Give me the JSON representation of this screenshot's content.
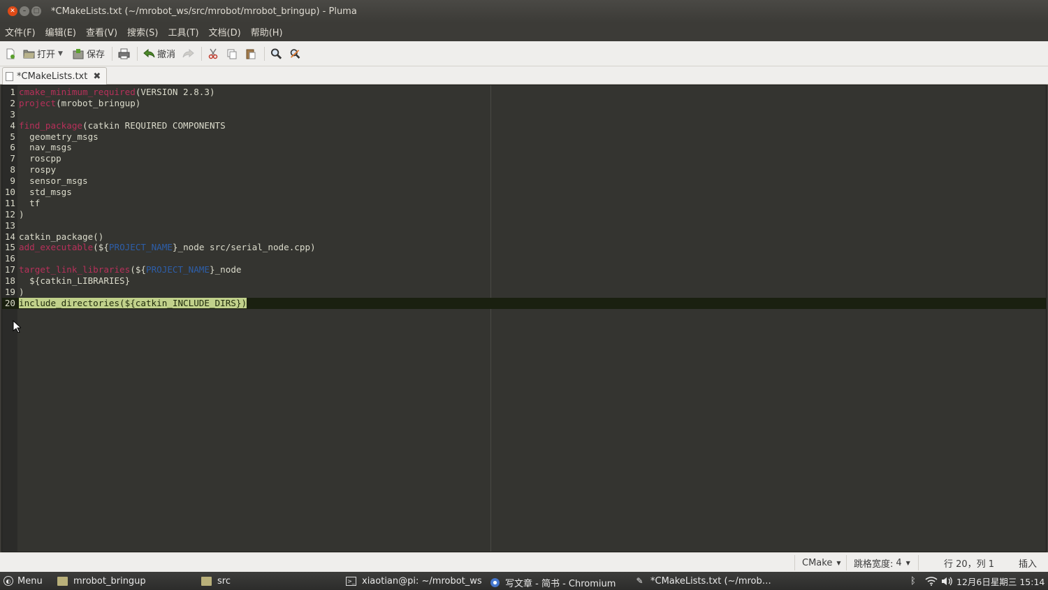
{
  "window": {
    "title": "*CMakeLists.txt (~/mrobot_ws/src/mrobot/mrobot_bringup) - Pluma"
  },
  "menu": {
    "items": [
      "文件(F)",
      "编辑(E)",
      "查看(V)",
      "搜索(S)",
      "工具(T)",
      "文档(D)",
      "帮助(H)"
    ]
  },
  "toolbar": {
    "open_label": "打开",
    "save_label": "保存",
    "undo_label": "撤消"
  },
  "tab": {
    "label": "*CMakeLists.txt"
  },
  "editor": {
    "current_line": 20,
    "lines": [
      {
        "n": "1",
        "segments": [
          {
            "t": "cmake_minimum_required",
            "c": "kw"
          },
          {
            "t": "(VERSION 2.8.3)",
            "c": "plain"
          }
        ]
      },
      {
        "n": "2",
        "segments": [
          {
            "t": "project",
            "c": "kw"
          },
          {
            "t": "(mrobot_bringup)",
            "c": "plain"
          }
        ]
      },
      {
        "n": "3",
        "segments": []
      },
      {
        "n": "4",
        "segments": [
          {
            "t": "find_package",
            "c": "kw"
          },
          {
            "t": "(catkin REQUIRED COMPONENTS",
            "c": "plain"
          }
        ]
      },
      {
        "n": "5",
        "segments": [
          {
            "t": "  geometry_msgs",
            "c": "plain"
          }
        ]
      },
      {
        "n": "6",
        "segments": [
          {
            "t": "  nav_msgs",
            "c": "plain"
          }
        ]
      },
      {
        "n": "7",
        "segments": [
          {
            "t": "  roscpp",
            "c": "plain"
          }
        ]
      },
      {
        "n": "8",
        "segments": [
          {
            "t": "  rospy",
            "c": "plain"
          }
        ]
      },
      {
        "n": "9",
        "segments": [
          {
            "t": "  sensor_msgs",
            "c": "plain"
          }
        ]
      },
      {
        "n": "10",
        "segments": [
          {
            "t": "  std_msgs",
            "c": "plain"
          }
        ]
      },
      {
        "n": "11",
        "segments": [
          {
            "t": "  tf",
            "c": "plain"
          }
        ]
      },
      {
        "n": "12",
        "segments": [
          {
            "t": ")",
            "c": "plain"
          }
        ]
      },
      {
        "n": "13",
        "segments": []
      },
      {
        "n": "14",
        "segments": [
          {
            "t": "catkin_package()",
            "c": "plain"
          }
        ]
      },
      {
        "n": "15",
        "segments": [
          {
            "t": "add_executable",
            "c": "kw"
          },
          {
            "t": "(${",
            "c": "plain"
          },
          {
            "t": "PROJECT_NAME",
            "c": "var"
          },
          {
            "t": "}_node src/serial_node.cpp)",
            "c": "plain"
          }
        ]
      },
      {
        "n": "16",
        "segments": []
      },
      {
        "n": "17",
        "segments": [
          {
            "t": "target_link_libraries",
            "c": "kw"
          },
          {
            "t": "(${",
            "c": "plain"
          },
          {
            "t": "PROJECT_NAME",
            "c": "var"
          },
          {
            "t": "}_node",
            "c": "plain"
          }
        ]
      },
      {
        "n": "18",
        "segments": [
          {
            "t": "  ${catkin_LIBRARIES}",
            "c": "plain"
          }
        ]
      },
      {
        "n": "19",
        "segments": [
          {
            "t": ")",
            "c": "plain"
          }
        ]
      },
      {
        "n": "20",
        "segments": [
          {
            "t": "include_directories(${catkin_INCLUDE_DIRS})",
            "c": "sel"
          }
        ]
      }
    ]
  },
  "statusbar": {
    "language": "CMake",
    "tab_width_label": "跳格宽度:",
    "tab_width_value": "4",
    "position": "行 20，列 1",
    "mode": "插入"
  },
  "taskbar": {
    "menu_label": "Menu",
    "tasks": [
      "mrobot_bringup",
      "src",
      "xiaotian@pi: ~/mrobot_ws",
      "写文章 - 简书 - Chromium",
      "*CMakeLists.txt (~/mrob…"
    ],
    "clock": "12月6日星期三 15:14"
  },
  "colors": {
    "keyword": "#b7305a",
    "variable": "#2d5ea9",
    "selection": "#c1d18b",
    "editor_bg": "#343430",
    "close_button": "#df4a16"
  }
}
